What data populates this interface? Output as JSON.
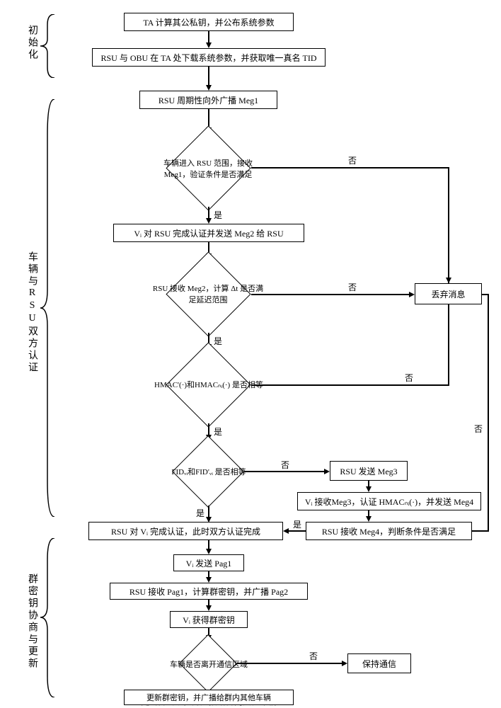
{
  "phases": {
    "init": "初始化",
    "auth": "车辆与RSU双方认证",
    "group": "群密钥协商与更新"
  },
  "nodes": {
    "n1": "TA 计算其公私钥，并公布系统参数",
    "n2": "RSU 与 OBU 在 TA 处下载系统参数，并获取唯一真名 TID",
    "n3": "RSU 周期性向外广播 Meg1",
    "d1": "车辆进入 RSU 范围，接收 Meg1，验证条件是否满足",
    "n4": "Vᵢ 对 RSU 完成认证并发送 Meg2 给 RSU",
    "d2": "RSU 接收 Meg2，计算 Δt 是否满足延迟范围",
    "d3": "HMAC'(·)和HMACₙᵢ(·) 是否相等",
    "d4": "FIDᵥᵢ和FID'ᵥᵢ 是否相等",
    "n5": "丢弃消息",
    "n6": "RSU 发送 Meg3",
    "n7": "Vᵢ 接收Meg3，认证 HMACₙᵢ(·)，并发送 Meg4",
    "n8": "RSU 接收 Meg4，判断条件是否满足",
    "n9": "RSU 对 Vᵢ 完成认证，此时双方认证完成",
    "n10": "Vᵢ 发送 Pag1",
    "n11": "RSU 接收 Pag1，计算群密钥，并广播 Pag2",
    "n12": "Vᵢ 获得群密钥",
    "d5": "车辆是否离开通信区域",
    "n13": "保持通信",
    "n14": "更新群密钥，并广播给群内其他车辆"
  },
  "labels": {
    "yes": "是",
    "no": "否"
  }
}
